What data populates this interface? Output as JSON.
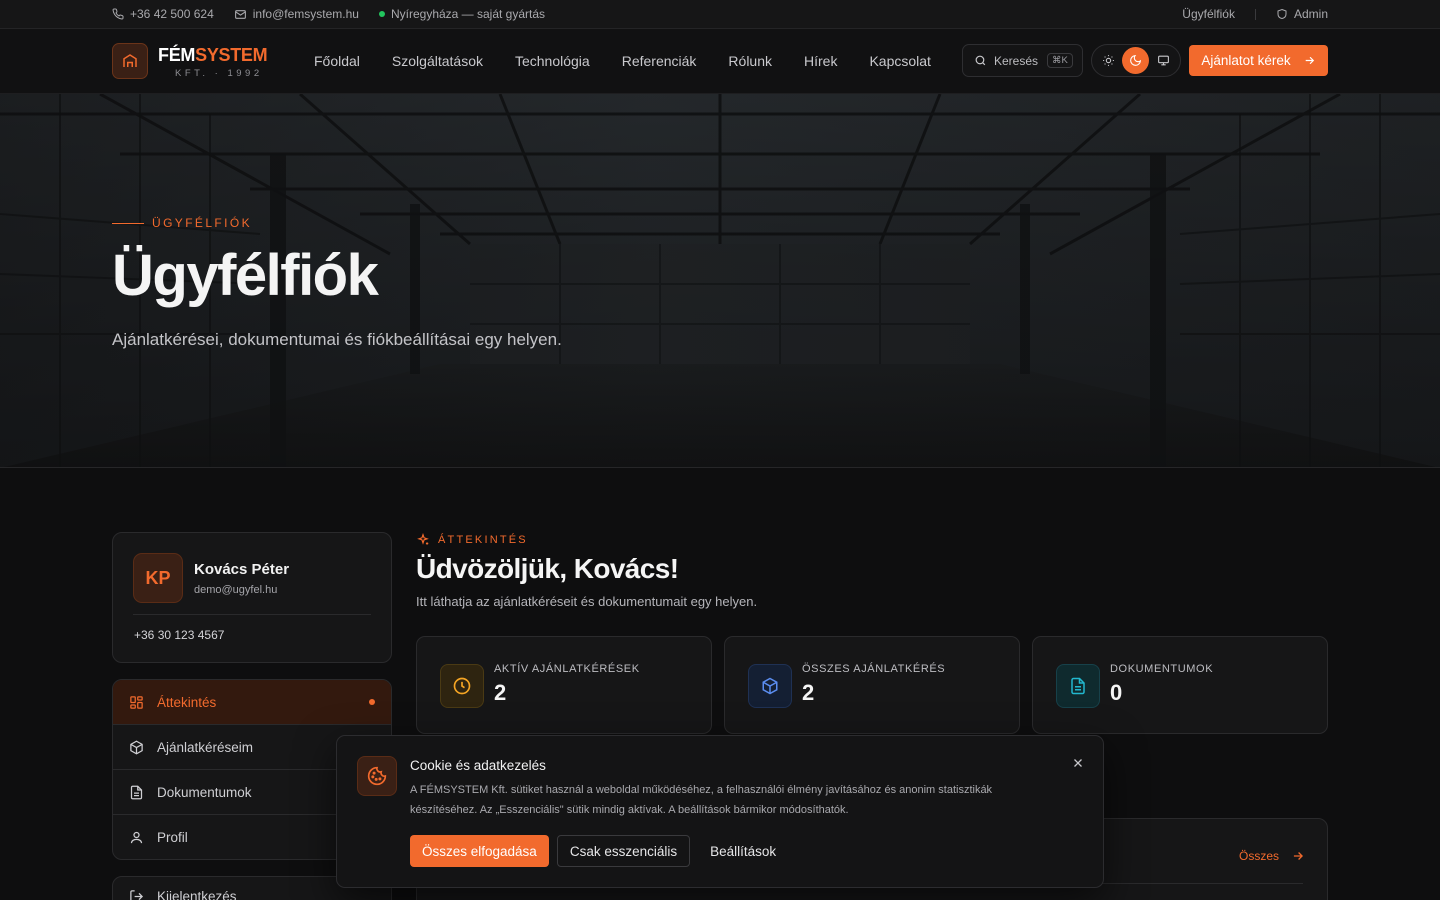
{
  "topbar": {
    "phone": "+36 42 500 624",
    "email": "info@femsystem.hu",
    "location": "Nyíregyháza — saját gyártás",
    "account_link": "Ügyfélfiók",
    "admin_link": "Admin"
  },
  "brand": {
    "name_white": "FÉM",
    "name_orange": "SYSTEM",
    "sub": "KFT. · 1992"
  },
  "nav": {
    "items": [
      {
        "label": "Főoldal"
      },
      {
        "label": "Szolgáltatások"
      },
      {
        "label": "Technológia"
      },
      {
        "label": "Referenciák"
      },
      {
        "label": "Rólunk"
      },
      {
        "label": "Hírek"
      },
      {
        "label": "Kapcsolat"
      }
    ],
    "search_label": "Keresés",
    "search_shortcut": "⌘K",
    "cta_label": "Ajánlatot kérek"
  },
  "hero": {
    "eyebrow": "ÜGYFÉLFIÓK",
    "title": "Ügyfélfiók",
    "subtitle": "Ajánlatkérései, dokumentumai és fiókbeállításai egy helyen."
  },
  "profile": {
    "initials": "KP",
    "name": "Kovács Péter",
    "email": "demo@ugyfel.hu",
    "phone": "+36 30 123 4567"
  },
  "sidebar": {
    "items": [
      {
        "label": "Áttekintés",
        "active": true
      },
      {
        "label": "Ajánlatkéréseim"
      },
      {
        "label": "Dokumentumok"
      },
      {
        "label": "Profil"
      }
    ],
    "logout": "Kijelentkezés"
  },
  "overview": {
    "eyebrow": "ÁTTEKINTÉS",
    "title": "Üdvözöljük, Kovács!",
    "subtitle": "Itt láthatja az ajánlatkéréseit és dokumentumait egy helyen."
  },
  "stats": [
    {
      "label": "AKTÍV AJÁNLATKÉRÉSEK",
      "value": "2",
      "color": "#f5a524"
    },
    {
      "label": "ÖSSZES AJÁNLATKÉRÉS",
      "value": "2",
      "color": "#5b8def"
    },
    {
      "label": "DOKUMENTUMOK",
      "value": "0",
      "color": "#22b8cf"
    }
  ],
  "recent": {
    "all_link": "Összes"
  },
  "cookie": {
    "title": "Cookie és adatkezelés",
    "text": "A FÉMSYSTEM Kft. sütiket használ a weboldal működéséhez, a felhasználói élmény javításához és anonim statisztikák készítéséhez. Az „Esszenciális\" sütik mindig aktívak. A beállítások bármikor módosíthatók.",
    "accept_all": "Összes elfogadása",
    "essential_only": "Csak esszenciális",
    "settings": "Beállítások"
  },
  "colors": {
    "accent": "#f26a2d",
    "background": "#0e0e0f"
  }
}
